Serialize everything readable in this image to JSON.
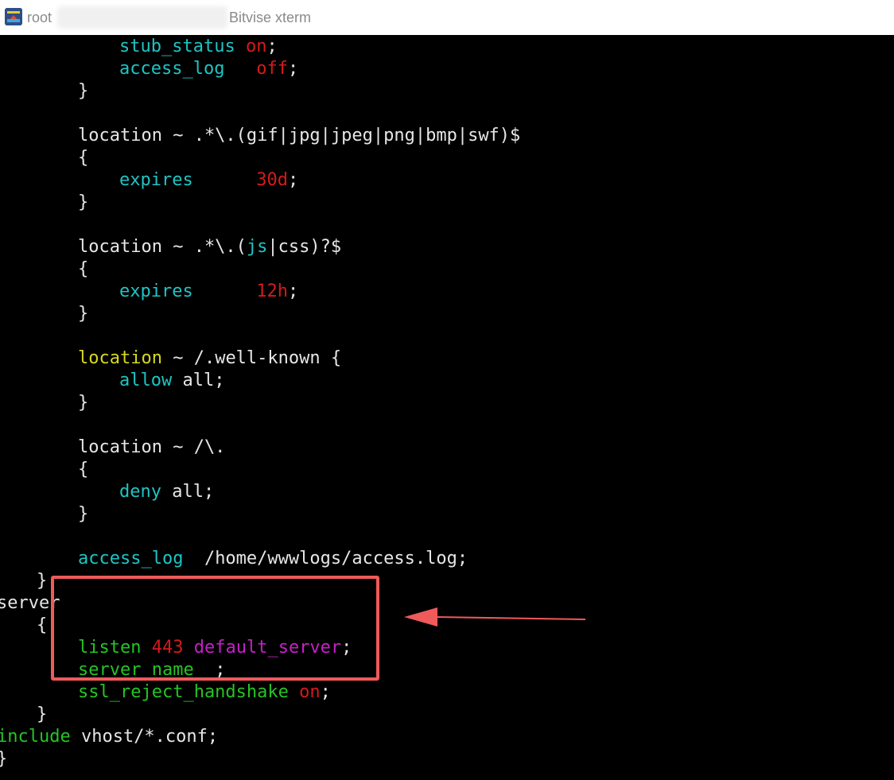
{
  "window": {
    "title_user": "root",
    "title_app": "Bitvise xterm",
    "icon": "bitvise-app-icon"
  },
  "terminal": {
    "lines": [
      [
        {
          "t": "stub_status",
          "c": "cyan"
        },
        {
          "t": " ",
          "c": "white"
        },
        {
          "t": "on",
          "c": "red"
        },
        {
          "t": ";",
          "c": "white"
        }
      ],
      [
        {
          "t": "access_log",
          "c": "cyan"
        },
        {
          "t": "   ",
          "c": "white"
        },
        {
          "t": "off",
          "c": "red"
        },
        {
          "t": ";",
          "c": "white"
        }
      ],
      [
        {
          "t": "}",
          "c": "white"
        }
      ],
      [],
      [
        {
          "t": "location ~ .*\\.(gif|jpg|jpeg|png|bmp|swf)$",
          "c": "white"
        }
      ],
      [
        {
          "t": "{",
          "c": "white"
        }
      ],
      [
        {
          "t": "expires",
          "c": "cyan"
        },
        {
          "t": "      ",
          "c": "white"
        },
        {
          "t": "30d",
          "c": "red"
        },
        {
          "t": ";",
          "c": "white"
        }
      ],
      [
        {
          "t": "}",
          "c": "white"
        }
      ],
      [],
      [
        {
          "t": "location ~ .*\\.(",
          "c": "white"
        },
        {
          "t": "js",
          "c": "cyan"
        },
        {
          "t": "|css)?$",
          "c": "white"
        }
      ],
      [
        {
          "t": "{",
          "c": "white"
        }
      ],
      [
        {
          "t": "expires",
          "c": "cyan"
        },
        {
          "t": "      ",
          "c": "white"
        },
        {
          "t": "12h",
          "c": "red"
        },
        {
          "t": ";",
          "c": "white"
        }
      ],
      [
        {
          "t": "}",
          "c": "white"
        }
      ],
      [],
      [
        {
          "t": "location",
          "c": "yellow"
        },
        {
          "t": " ~ /.well-known {",
          "c": "white"
        }
      ],
      [
        {
          "t": "allow",
          "c": "cyan"
        },
        {
          "t": " all;",
          "c": "white"
        }
      ],
      [
        {
          "t": "}",
          "c": "white"
        }
      ],
      [],
      [
        {
          "t": "location ~ /\\.",
          "c": "white"
        }
      ],
      [
        {
          "t": "{",
          "c": "white"
        }
      ],
      [
        {
          "t": "deny",
          "c": "cyan"
        },
        {
          "t": " all;",
          "c": "white"
        }
      ],
      [
        {
          "t": "}",
          "c": "white"
        }
      ],
      [],
      [
        {
          "t": "access_log",
          "c": "cyan"
        },
        {
          "t": "  /home/wwwlogs/access.log;",
          "c": "white"
        }
      ],
      [
        {
          "t": "}",
          "c": "white"
        }
      ],
      [
        {
          "t": "server",
          "c": "white"
        }
      ],
      [
        {
          "t": "{",
          "c": "white"
        }
      ],
      [
        {
          "t": "listen",
          "c": "green"
        },
        {
          "t": " ",
          "c": "white"
        },
        {
          "t": "443",
          "c": "red"
        },
        {
          "t": " ",
          "c": "white"
        },
        {
          "t": "default_server",
          "c": "magenta"
        },
        {
          "t": ";",
          "c": "white"
        }
      ],
      [
        {
          "t": "server_name",
          "c": "green"
        },
        {
          "t": " _;",
          "c": "white"
        }
      ],
      [
        {
          "t": "ssl_reject_handshake",
          "c": "green"
        },
        {
          "t": " ",
          "c": "white"
        },
        {
          "t": "on",
          "c": "red"
        },
        {
          "t": ";",
          "c": "white"
        }
      ],
      [
        {
          "t": "}",
          "c": "white"
        }
      ],
      [
        {
          "t": "include",
          "c": "green"
        },
        {
          "t": " vhost/*.conf;",
          "c": "white"
        }
      ],
      [
        {
          "t": "}",
          "c": "white"
        }
      ]
    ]
  },
  "colors": {
    "cyan": "#1fc4c4",
    "red": "#d61a1a",
    "yellow": "#d8d820",
    "green": "#25c425",
    "magenta": "#c71fc7",
    "white": "#e6e6e6",
    "annotation": "#ef5a5a"
  },
  "annotation": {
    "box": "highlight-box",
    "arrow": "arrow-left-icon"
  }
}
